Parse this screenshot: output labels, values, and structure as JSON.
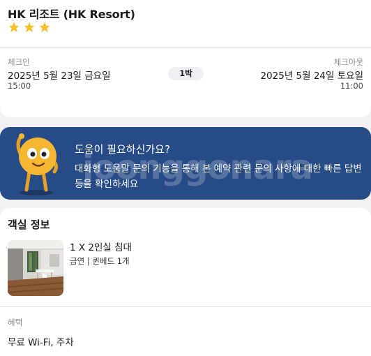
{
  "hotel": {
    "name": "HK 리조트 (HK Resort)",
    "star_rating": 3,
    "star_icon": "star-icon",
    "star_color": "#f2c230"
  },
  "stay": {
    "checkin_label": "체크인",
    "checkin_date": "2025년 5월 23일 금요일",
    "checkin_time": "15:00",
    "nights": "1박",
    "checkout_label": "체크아웃",
    "checkout_date": "2025년 5월 24일 토요일",
    "checkout_time": "11:00"
  },
  "help": {
    "title": "도움이 필요하신가요?",
    "description": "대화형 도움말 문의 기능을 통해 본 예약 관련 문의 사항에 대한 빠른 답변 등을 확인하세요",
    "background_color": "#274b86",
    "mascot_icon": "mascot-icon",
    "watermark": "joonggonara"
  },
  "room": {
    "heading": "객실 정보",
    "name": "1 X 2인실 침대",
    "detail": "금연 | 퀸베드 1개",
    "photo_icon": "room-photo"
  },
  "benefits": {
    "label": "혜택",
    "value": "무료 Wi-Fi, 주차"
  }
}
